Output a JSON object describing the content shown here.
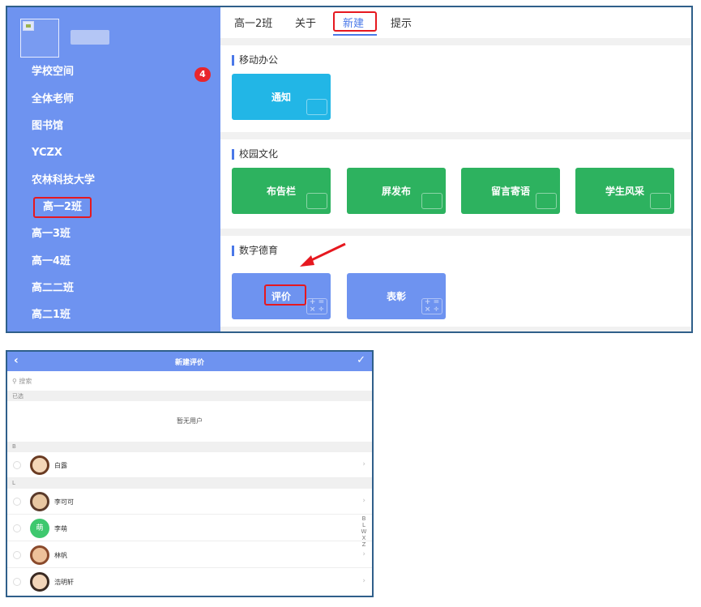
{
  "sidebar": {
    "items": [
      {
        "label": "学校空间",
        "badge": "4"
      },
      {
        "label": "全体老师"
      },
      {
        "label": "图书馆"
      },
      {
        "label": "YCZX"
      },
      {
        "label": "农林科技大学"
      },
      {
        "label": "高一2班"
      },
      {
        "label": "高一3班"
      },
      {
        "label": "高一4班"
      },
      {
        "label": "高二二班"
      },
      {
        "label": "高二1班"
      }
    ]
  },
  "tabs": [
    {
      "label": "高一2班"
    },
    {
      "label": "关于"
    },
    {
      "label": "新建"
    },
    {
      "label": "提示"
    }
  ],
  "sections": [
    {
      "title": "移动办公",
      "cards": [
        {
          "label": "通知",
          "color": "#22b6e6"
        }
      ]
    },
    {
      "title": "校园文化",
      "cards": [
        {
          "label": "布告栏"
        },
        {
          "label": "屏发布"
        },
        {
          "label": "留言寄语"
        },
        {
          "label": "学生风采"
        }
      ]
    },
    {
      "title": "数字德育",
      "cards": [
        {
          "label": "评价"
        },
        {
          "label": "表彰"
        }
      ]
    }
  ],
  "phone": {
    "title": "新建评价",
    "search_placeholder": "搜索",
    "selected_group": "已选",
    "empty_text": "暂无用户",
    "group_b": "B",
    "group_l": "L",
    "contacts": [
      {
        "name": "白露"
      },
      {
        "name": "李可可"
      },
      {
        "name": "李萌",
        "avatar_text": "萌"
      },
      {
        "name": "林帆"
      },
      {
        "name": "浩明轩"
      }
    ],
    "index_letters": [
      "B",
      "L",
      "W",
      "X",
      "Z"
    ]
  },
  "colors": {
    "accent": "#4a78e8",
    "sidebar": "#6e93f0",
    "green_card": "#2db25f",
    "highlight": "#e6181f"
  }
}
